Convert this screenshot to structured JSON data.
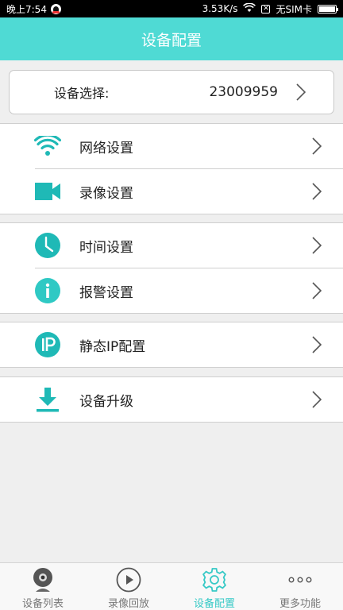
{
  "status_bar": {
    "time": "晚上7:54",
    "speed": "3.53K/s",
    "sim": "无SIM卡"
  },
  "header": {
    "title": "设备配置"
  },
  "device_select": {
    "label": "设备选择:",
    "value": "23009959"
  },
  "groups": [
    [
      {
        "icon": "wifi-icon",
        "label": "网络设置"
      },
      {
        "icon": "video-camera-icon",
        "label": "录像设置"
      }
    ],
    [
      {
        "icon": "clock-icon",
        "label": "时间设置"
      },
      {
        "icon": "info-icon",
        "label": "报警设置"
      }
    ],
    [
      {
        "icon": "ip-icon",
        "label": "静态IP配置",
        "icon_text": "IP"
      }
    ],
    [
      {
        "icon": "download-icon",
        "label": "设备升级"
      }
    ]
  ],
  "tabs": [
    {
      "icon": "webcam-icon",
      "label": "设备列表",
      "active": false
    },
    {
      "icon": "play-circle-icon",
      "label": "录像回放",
      "active": false
    },
    {
      "icon": "gear-icon",
      "label": "设备配置",
      "active": true
    },
    {
      "icon": "more-dots-icon",
      "label": "更多功能",
      "active": false
    }
  ],
  "colors": {
    "accent": "#4fdad4",
    "icon_teal": "#1fb9b6",
    "active_tab": "#36c9c6"
  }
}
